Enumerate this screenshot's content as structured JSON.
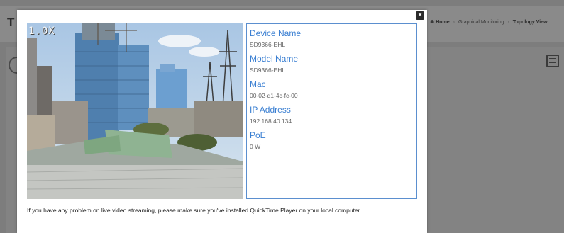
{
  "background": {
    "title": "T",
    "breadcrumb": {
      "home": "Home",
      "items": [
        "Graphical Monitoring",
        "Topology View"
      ]
    }
  },
  "modal": {
    "close_icon": "close-icon",
    "video": {
      "zoom_label": "1.0X"
    },
    "device_info": [
      {
        "label": "Device Name",
        "value": "SD9366-EHL"
      },
      {
        "label": "Model Name",
        "value": "SD9366-EHL"
      },
      {
        "label": "Mac",
        "value": "00-02-d1-4c-fc-00"
      },
      {
        "label": "IP Address",
        "value": "192.168.40.134"
      },
      {
        "label": "PoE",
        "value": "0 W"
      }
    ],
    "notice": "If you have any problem on live video streaming, please make sure you've installed QuickTime Player on your local computer."
  },
  "colors": {
    "accent": "#3a7fd2",
    "info_border": "#5b8fcf",
    "overlay": "#7d7d7d"
  }
}
